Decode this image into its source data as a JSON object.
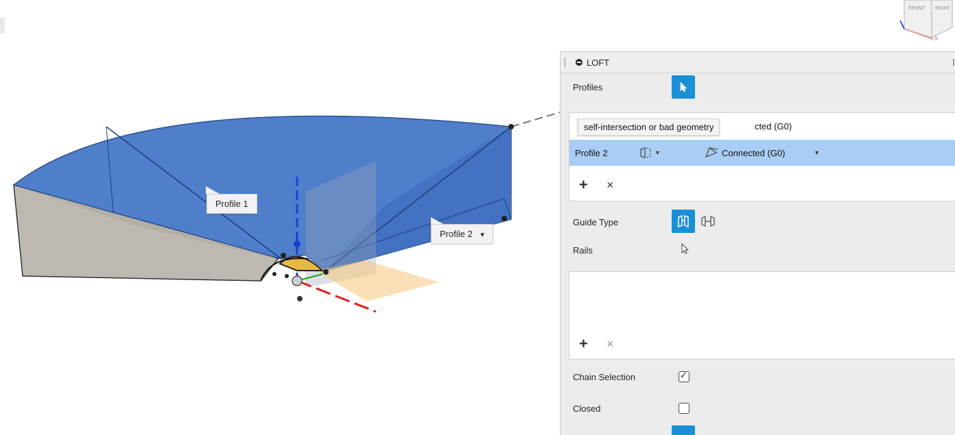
{
  "viewport": {
    "labels": {
      "profile1": "Profile 1",
      "profile2": "Profile 2",
      "profile2_caret": "▾"
    },
    "viewcube": {
      "front": "FRONT",
      "right": "RIGHT",
      "axis_x": "X"
    },
    "colors": {
      "body_blue": "#4f7fcb",
      "side_gray": "#b9b6ad",
      "selection_blue": "#1a8fd6"
    }
  },
  "panel": {
    "title": "LOFT",
    "profiles": {
      "label": "Profiles",
      "list": [
        {
          "name": "Profile 1",
          "continuity": "Connected (G0)",
          "tooltip": "self-intersection or bad geometry",
          "visible_continuity": "cted (G0)"
        },
        {
          "name": "Profile 2",
          "continuity": "Connected (G0)"
        }
      ],
      "add": "+",
      "remove": "×"
    },
    "guide_type": {
      "label": "Guide Type"
    },
    "rails": {
      "label": "Rails",
      "add": "+",
      "remove": "×"
    },
    "chain_selection": {
      "label": "Chain Selection",
      "checked": true
    },
    "closed": {
      "label": "Closed",
      "checked": false
    },
    "caret": "▾",
    "check_mark": "✓"
  }
}
